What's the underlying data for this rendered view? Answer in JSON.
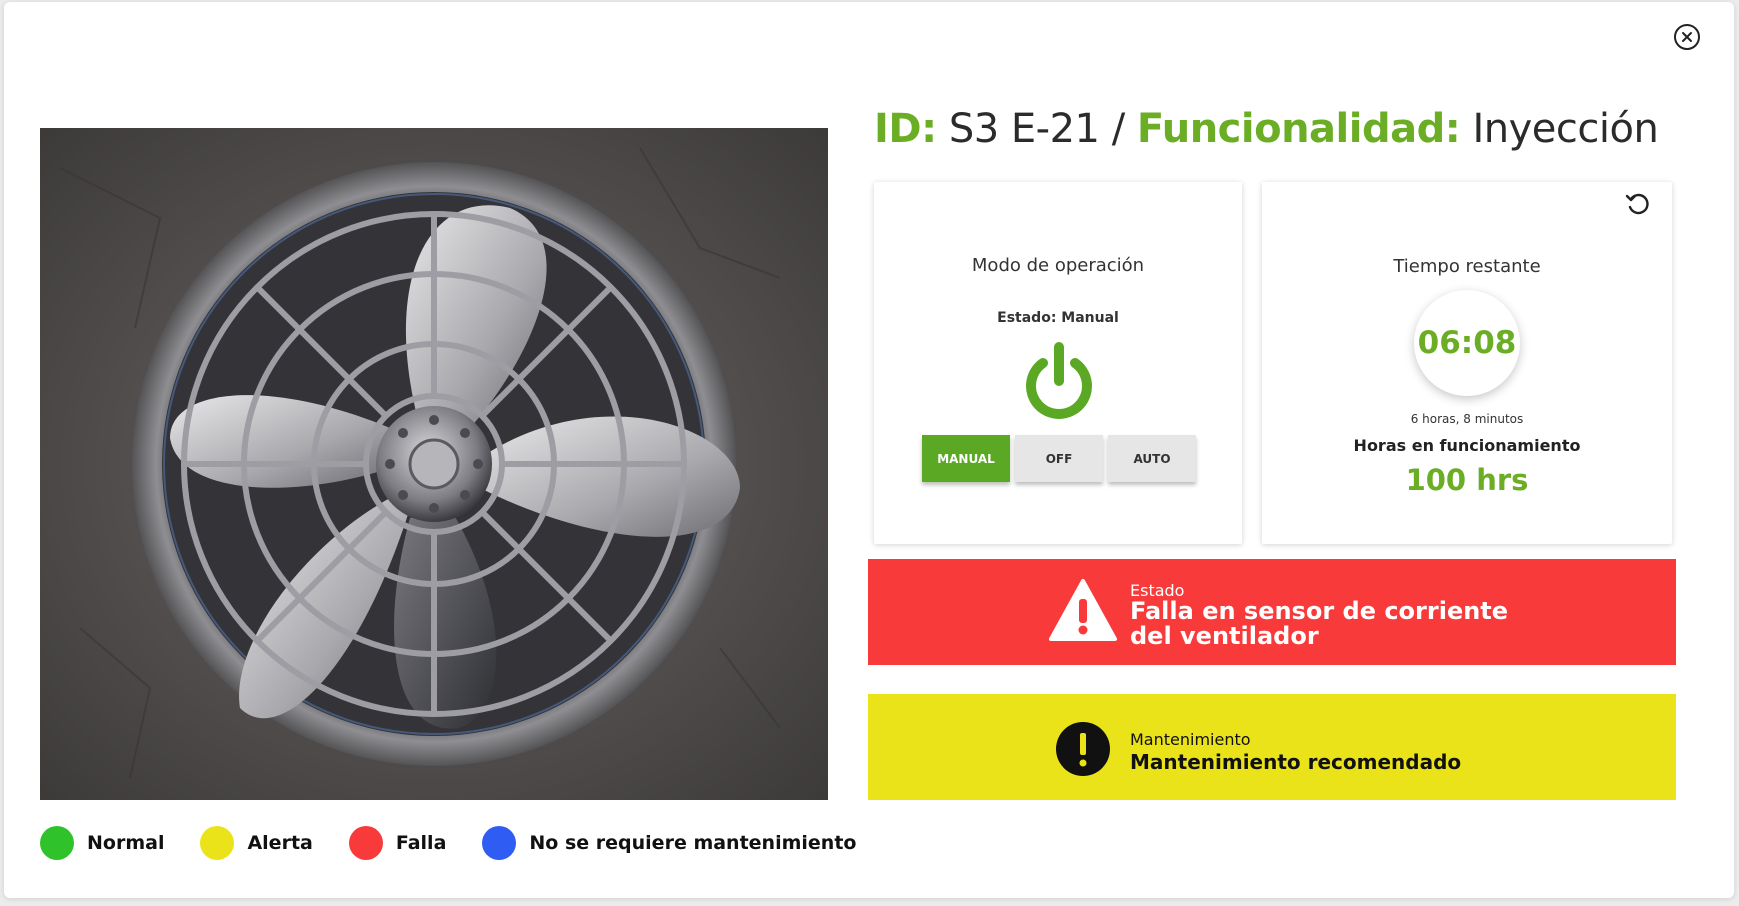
{
  "title": {
    "id_label": "ID:",
    "id_value": "S3 E-21 /",
    "func_label": "Funcionalidad:",
    "func_value": "Inyección"
  },
  "close_icon": "close-circle-icon",
  "image": {
    "description_icon": "fan-photo"
  },
  "mode_card": {
    "title": "Modo de operación",
    "estado": "Estado: Manual",
    "power_icon": "power-icon",
    "buttons": [
      {
        "label": "MANUAL",
        "active": true
      },
      {
        "label": "OFF",
        "active": false
      },
      {
        "label": "AUTO",
        "active": false
      }
    ]
  },
  "time_card": {
    "title": "Tiempo restante",
    "refresh_icon": "refresh-icon",
    "timer": "06:08",
    "timer_sub": "6 horas, 8 minutos",
    "hours_label": "Horas en funcionamiento",
    "hours_value": "100 hrs"
  },
  "status_banner": {
    "label": "Estado",
    "message_line1": "Falla en sensor de corriente",
    "message_line2": "del ventilador",
    "icon": "warning-triangle-icon",
    "color": "#f83a3a"
  },
  "maintenance_banner": {
    "label": "Mantenimiento",
    "message": "Mantenimiento recomendado",
    "icon": "exclamation-circle-icon",
    "color": "#ebe31a"
  },
  "legend": [
    {
      "label": "Normal",
      "color": "#2fc22a"
    },
    {
      "label": "Alerta",
      "color": "#ebe31a"
    },
    {
      "label": "Falla",
      "color": "#f83a3a"
    },
    {
      "label": "No se requiere mantenimiento",
      "color": "#2f5cf2"
    }
  ],
  "colors": {
    "accent_green": "#6bad25",
    "button_active": "#5aa823"
  }
}
